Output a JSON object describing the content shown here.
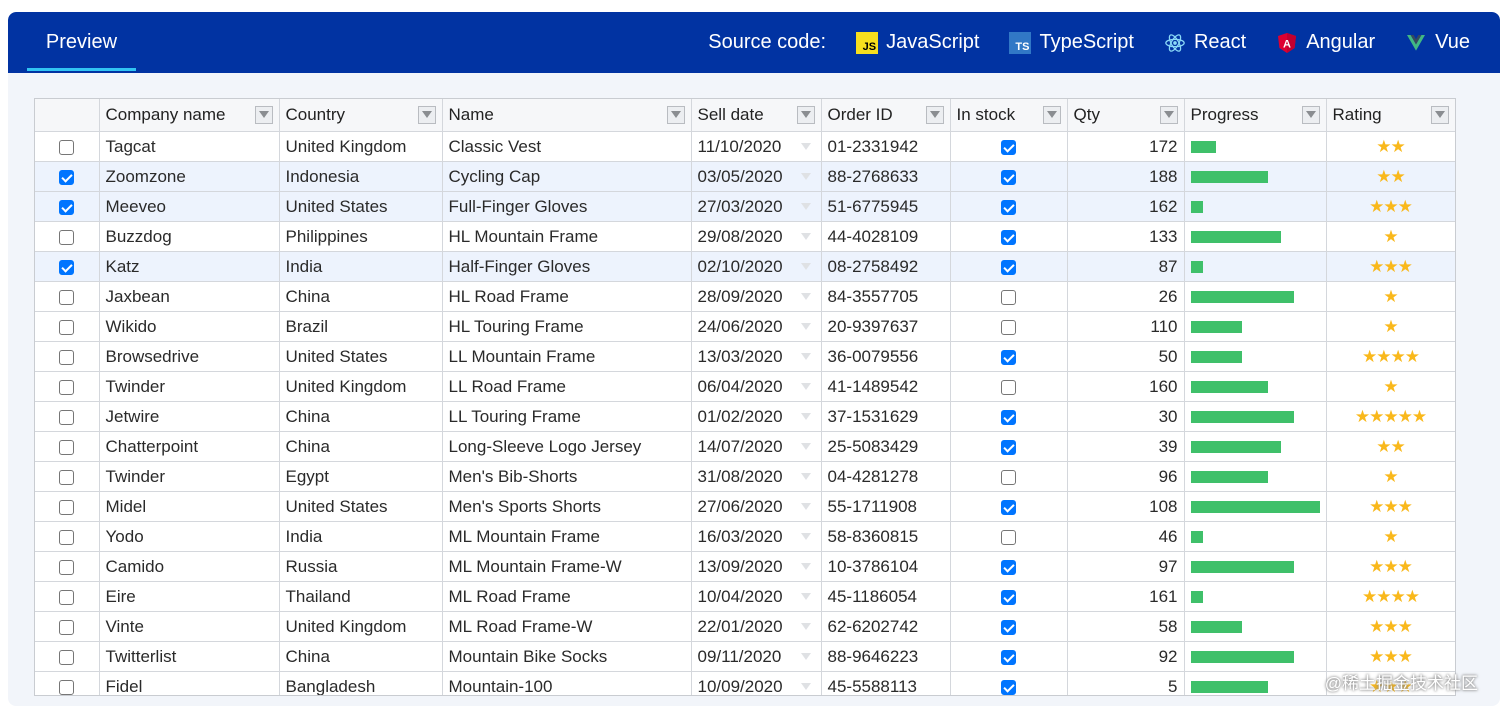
{
  "header": {
    "tab_preview": "Preview",
    "source_label": "Source code:",
    "sources": [
      {
        "label": "JavaScript",
        "icon": "javascript-icon",
        "badge": "JS"
      },
      {
        "label": "TypeScript",
        "icon": "typescript-icon",
        "badge": "TS"
      },
      {
        "label": "React",
        "icon": "react-icon"
      },
      {
        "label": "Angular",
        "icon": "angular-icon"
      },
      {
        "label": "Vue",
        "icon": "vue-icon"
      }
    ]
  },
  "colors": {
    "header_bg": "#0133a2",
    "tab_underline": "#31c4f3",
    "progress": "#3fc06a",
    "star": "#f9b81b",
    "checkbox": "#0075ff",
    "selected_row": "#edf3fd"
  },
  "columns": [
    "Company name",
    "Country",
    "Name",
    "Sell date",
    "Order ID",
    "In stock",
    "Qty",
    "Progress",
    "Rating"
  ],
  "rows": [
    {
      "selected": false,
      "company": "Tagcat",
      "country": "United Kingdom",
      "name": "Classic Vest",
      "date": "11/10/2020",
      "order": "01-2331942",
      "stock": true,
      "qty": "172",
      "progress": 20,
      "rating": 2
    },
    {
      "selected": true,
      "company": "Zoomzone",
      "country": "Indonesia",
      "name": "Cycling Cap",
      "date": "03/05/2020",
      "order": "88-2768633",
      "stock": true,
      "qty": "188",
      "progress": 60,
      "rating": 2
    },
    {
      "selected": true,
      "company": "Meeveo",
      "country": "United States",
      "name": "Full-Finger Gloves",
      "date": "27/03/2020",
      "order": "51-6775945",
      "stock": true,
      "qty": "162",
      "progress": 10,
      "rating": 3
    },
    {
      "selected": false,
      "company": "Buzzdog",
      "country": "Philippines",
      "name": "HL Mountain Frame",
      "date": "29/08/2020",
      "order": "44-4028109",
      "stock": true,
      "qty": "133",
      "progress": 70,
      "rating": 1
    },
    {
      "selected": true,
      "company": "Katz",
      "country": "India",
      "name": "Half-Finger Gloves",
      "date": "02/10/2020",
      "order": "08-2758492",
      "stock": true,
      "qty": "87",
      "progress": 10,
      "rating": 3
    },
    {
      "selected": false,
      "company": "Jaxbean",
      "country": "China",
      "name": "HL Road Frame",
      "date": "28/09/2020",
      "order": "84-3557705",
      "stock": false,
      "qty": "26",
      "progress": 80,
      "rating": 1
    },
    {
      "selected": false,
      "company": "Wikido",
      "country": "Brazil",
      "name": "HL Touring Frame",
      "date": "24/06/2020",
      "order": "20-9397637",
      "stock": false,
      "qty": "110",
      "progress": 40,
      "rating": 1
    },
    {
      "selected": false,
      "company": "Browsedrive",
      "country": "United States",
      "name": "LL Mountain Frame",
      "date": "13/03/2020",
      "order": "36-0079556",
      "stock": true,
      "qty": "50",
      "progress": 40,
      "rating": 4
    },
    {
      "selected": false,
      "company": "Twinder",
      "country": "United Kingdom",
      "name": "LL Road Frame",
      "date": "06/04/2020",
      "order": "41-1489542",
      "stock": false,
      "qty": "160",
      "progress": 60,
      "rating": 1
    },
    {
      "selected": false,
      "company": "Jetwire",
      "country": "China",
      "name": "LL Touring Frame",
      "date": "01/02/2020",
      "order": "37-1531629",
      "stock": true,
      "qty": "30",
      "progress": 80,
      "rating": 5
    },
    {
      "selected": false,
      "company": "Chatterpoint",
      "country": "China",
      "name": "Long-Sleeve Logo Jersey",
      "date": "14/07/2020",
      "order": "25-5083429",
      "stock": true,
      "qty": "39",
      "progress": 70,
      "rating": 2
    },
    {
      "selected": false,
      "company": "Twinder",
      "country": "Egypt",
      "name": "Men's Bib-Shorts",
      "date": "31/08/2020",
      "order": "04-4281278",
      "stock": false,
      "qty": "96",
      "progress": 60,
      "rating": 1
    },
    {
      "selected": false,
      "company": "Midel",
      "country": "United States",
      "name": "Men's Sports Shorts",
      "date": "27/06/2020",
      "order": "55-1711908",
      "stock": true,
      "qty": "108",
      "progress": 100,
      "rating": 3
    },
    {
      "selected": false,
      "company": "Yodo",
      "country": "India",
      "name": "ML Mountain Frame",
      "date": "16/03/2020",
      "order": "58-8360815",
      "stock": false,
      "qty": "46",
      "progress": 10,
      "rating": 1
    },
    {
      "selected": false,
      "company": "Camido",
      "country": "Russia",
      "name": "ML Mountain Frame-W",
      "date": "13/09/2020",
      "order": "10-3786104",
      "stock": true,
      "qty": "97",
      "progress": 80,
      "rating": 3
    },
    {
      "selected": false,
      "company": "Eire",
      "country": "Thailand",
      "name": "ML Road Frame",
      "date": "10/04/2020",
      "order": "45-1186054",
      "stock": true,
      "qty": "161",
      "progress": 10,
      "rating": 4
    },
    {
      "selected": false,
      "company": "Vinte",
      "country": "United Kingdom",
      "name": "ML Road Frame-W",
      "date": "22/01/2020",
      "order": "62-6202742",
      "stock": true,
      "qty": "58",
      "progress": 40,
      "rating": 3
    },
    {
      "selected": false,
      "company": "Twitterlist",
      "country": "China",
      "name": "Mountain Bike Socks",
      "date": "09/11/2020",
      "order": "88-9646223",
      "stock": true,
      "qty": "92",
      "progress": 80,
      "rating": 3
    },
    {
      "selected": false,
      "company": "Fidel",
      "country": "Bangladesh",
      "name": "Mountain-100",
      "date": "10/09/2020",
      "order": "45-5588113",
      "stock": true,
      "qty": "5",
      "progress": 60,
      "rating": 3
    }
  ],
  "watermark": "@稀土掘金技术社区"
}
